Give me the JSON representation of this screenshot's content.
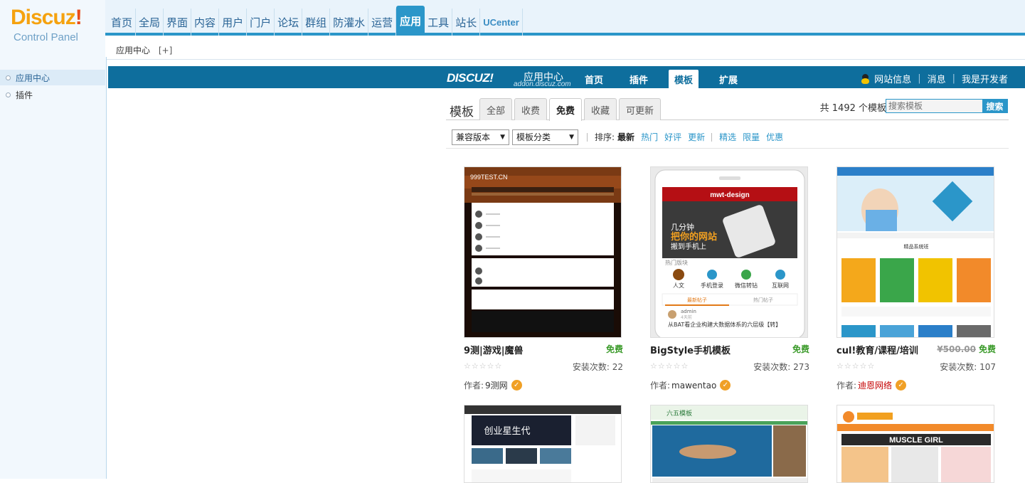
{
  "logo": {
    "brand": "Discuz",
    "bang": "!",
    "sub": "Control Panel"
  },
  "topnav": [
    "首页",
    "全局",
    "界面",
    "内容",
    "用户",
    "门户",
    "论坛",
    "群组",
    "防灌水",
    "运营",
    "应用",
    "工具",
    "站长",
    "UCenter"
  ],
  "topnav_active": "应用",
  "breadcrumb": {
    "current": "应用中心",
    "plus": "[+]"
  },
  "sidebar": {
    "items": [
      {
        "label": "应用中心",
        "active": true
      },
      {
        "label": "插件",
        "active": false
      }
    ]
  },
  "appcenter": {
    "logo_mark": "DISCUZ!",
    "logo_cn": "应用中心",
    "logo_url": "addon.discuz.com",
    "tabs": [
      "首页",
      "插件",
      "模板",
      "扩展"
    ],
    "active_tab": "模板",
    "right_links": [
      "网站信息",
      "消息",
      "我是开发者"
    ]
  },
  "filters": {
    "title": "模板",
    "tabs": [
      "全部",
      "收费",
      "免费",
      "收藏",
      "可更新"
    ],
    "active_tab": "免费",
    "total_text": "共 1492 个模板",
    "search_placeholder": "搜索模板",
    "search_button": "搜索"
  },
  "sortbar": {
    "select1": "兼容版本",
    "select2": "模板分类",
    "sort_label": "排序:",
    "sort_links": [
      "最新",
      "热门",
      "好评",
      "更新"
    ],
    "sort_active": "最新",
    "extra_links": [
      "精选",
      "限量",
      "优惠"
    ]
  },
  "cards": [
    {
      "name": "9测|游戏|魔兽",
      "price": "免费",
      "old_price": "",
      "installs_label": "安装次数:",
      "installs": "22",
      "author_label": "作者:",
      "author": "9测网",
      "author_red": false,
      "thumb_text": "999TEST.CN"
    },
    {
      "name": "BigStyle手机模板",
      "price": "免费",
      "old_price": "",
      "installs_label": "安装次数:",
      "installs": "273",
      "author_label": "作者:",
      "author": "mawentao",
      "author_red": false,
      "thumb_text": "mwt-design"
    },
    {
      "name": "cul!教育/课程/培训",
      "price": "免费",
      "old_price": "¥500.00",
      "installs_label": "安装次数:",
      "installs": "107",
      "author_label": "作者:",
      "author": "迪恩网络",
      "author_red": true,
      "thumb_text": "精品系统班"
    }
  ],
  "thumb2": {
    "phone_lines": [
      "几分钟",
      "把你的网站",
      "搬到手机上"
    ],
    "section": "热门版块",
    "icons": [
      "人文",
      "手机登录",
      "微信转钻",
      "互联网"
    ],
    "tabs": [
      "最新帖子",
      "热门帖子"
    ],
    "post_user": "admin",
    "post_time": "4天前",
    "post_title": "从BAT看企业构建大数据体系的六层级【转】"
  },
  "row2_texts": [
    "创业星生代",
    "六五模板",
    "MUSCLE GIRL"
  ]
}
